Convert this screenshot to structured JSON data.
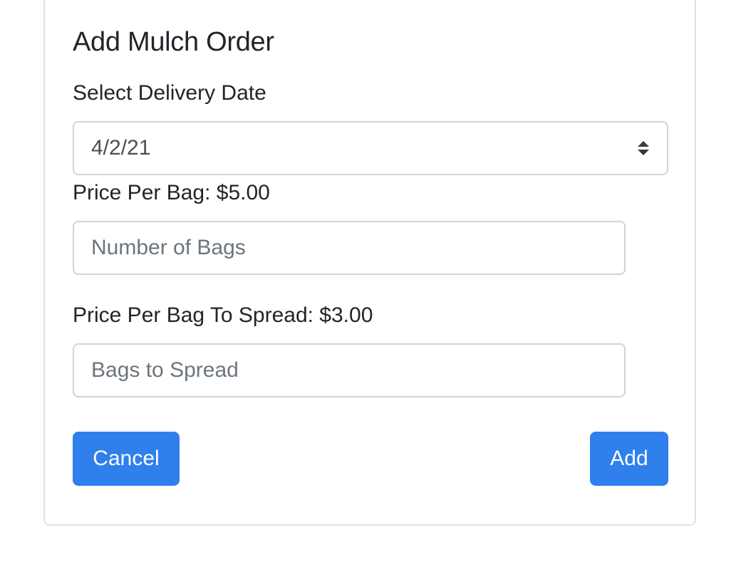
{
  "form": {
    "title": "Add Mulch Order",
    "delivery_date_label": "Select Delivery Date",
    "delivery_date_selected": "4/2/21",
    "price_per_bag_label": "Price Per Bag: $5.00",
    "bags_placeholder": "Number of Bags",
    "price_per_spread_label": "Price Per Bag To Spread: $3.00",
    "spread_placeholder": "Bags to Spread",
    "cancel_label": "Cancel",
    "add_label": "Add"
  },
  "colors": {
    "primary": "#2f80ed",
    "border": "#ced4da",
    "text": "#212529",
    "placeholder": "#6c757d"
  },
  "icons": {
    "select_arrows": "sort-arrows-icon"
  }
}
